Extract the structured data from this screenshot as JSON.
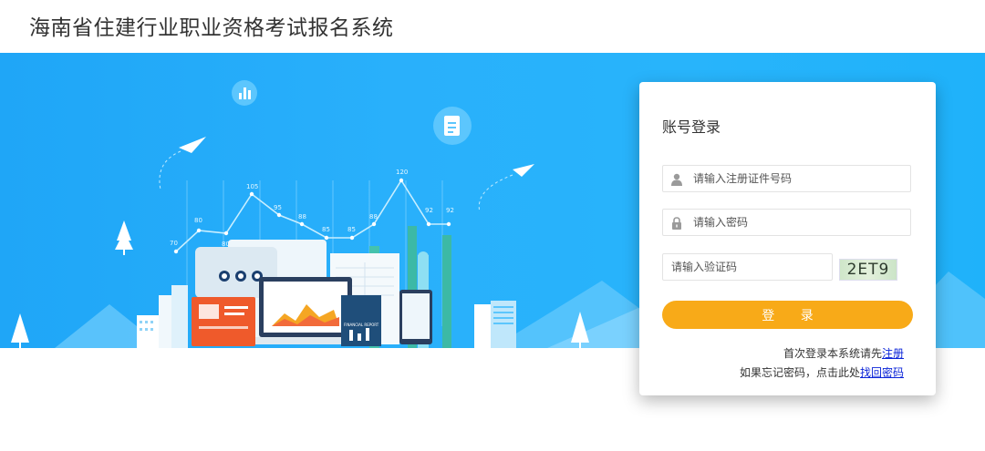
{
  "header": {
    "title": "海南省住建行业职业资格考试报名系统"
  },
  "banner": {
    "chart_labels": [
      "70",
      "80",
      "80",
      "105",
      "95",
      "88",
      "85",
      "85",
      "88",
      "120",
      "92",
      "92"
    ],
    "report_caption": "FINANCIAL REPORT",
    "icons": [
      "chart-bubble-icon",
      "document-bubble-icon",
      "paper-plane-icon",
      "tree-icon",
      "building-icon"
    ]
  },
  "login": {
    "title": "账号登录",
    "id_placeholder": "请输入注册证件号码",
    "password_placeholder": "请输入密码",
    "captcha_placeholder": "请输入验证码",
    "captcha_text": "2ET9",
    "submit_label": "登 录",
    "register_prefix": "首次登录本系统请先",
    "register_link": "注册",
    "forgot_prefix": "如果忘记密码，点击此处",
    "forgot_link": "找回密码"
  },
  "colors": {
    "banner": "#28b0fb",
    "button": "#f8aa18",
    "link": "#0a23d8"
  }
}
